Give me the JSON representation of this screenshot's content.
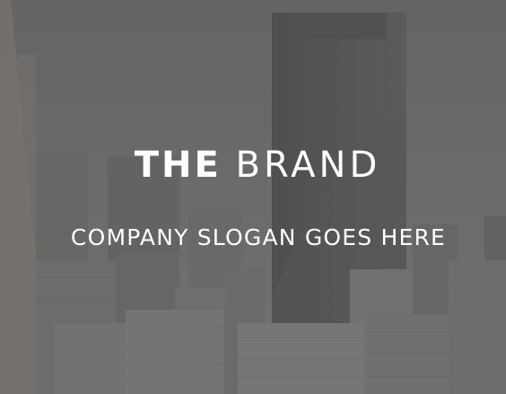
{
  "hero": {
    "brand_strong": "THE",
    "brand_light": "BRAND",
    "slogan": "COMPANY SLOGAN GOES HERE"
  },
  "background": {
    "image": "city-skyline-photo",
    "overlay_color": "#5a5a5a"
  },
  "colors": {
    "text": "#ffffff"
  }
}
